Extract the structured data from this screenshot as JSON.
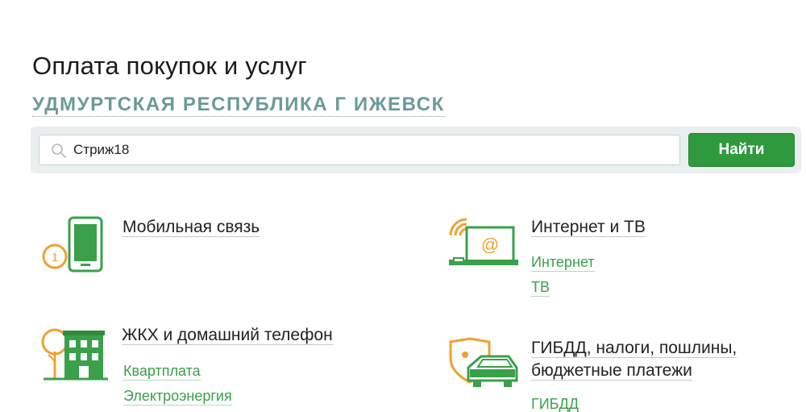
{
  "page": {
    "title": "Оплата покупок и услуг",
    "region": "УДМУРТСКАЯ РЕСПУБЛИКА Г ИЖЕВСК"
  },
  "search": {
    "value": "Стриж18",
    "button_label": "Найти"
  },
  "categories": [
    {
      "title": "Мобильная связь",
      "icon": "mobile-phone-icon",
      "links": []
    },
    {
      "title": "Интернет и ТВ",
      "icon": "laptop-wifi-icon",
      "links": [
        "Интернет",
        "ТВ"
      ]
    },
    {
      "title": "ЖКХ и домашний телефон",
      "icon": "house-tree-icon",
      "links": [
        "Квартплата",
        "Электроэнергия"
      ]
    },
    {
      "title_line1": "ГИБДД, налоги, пошлины,",
      "title_line2": "бюджетные платежи",
      "icon": "car-shield-icon",
      "links": [
        "ГИБДД"
      ]
    }
  ],
  "colors": {
    "accent_green": "#2f9a3d",
    "link_green": "#3aa04a",
    "icon_orange": "#f0a030",
    "region_teal": "#6b9a98"
  }
}
